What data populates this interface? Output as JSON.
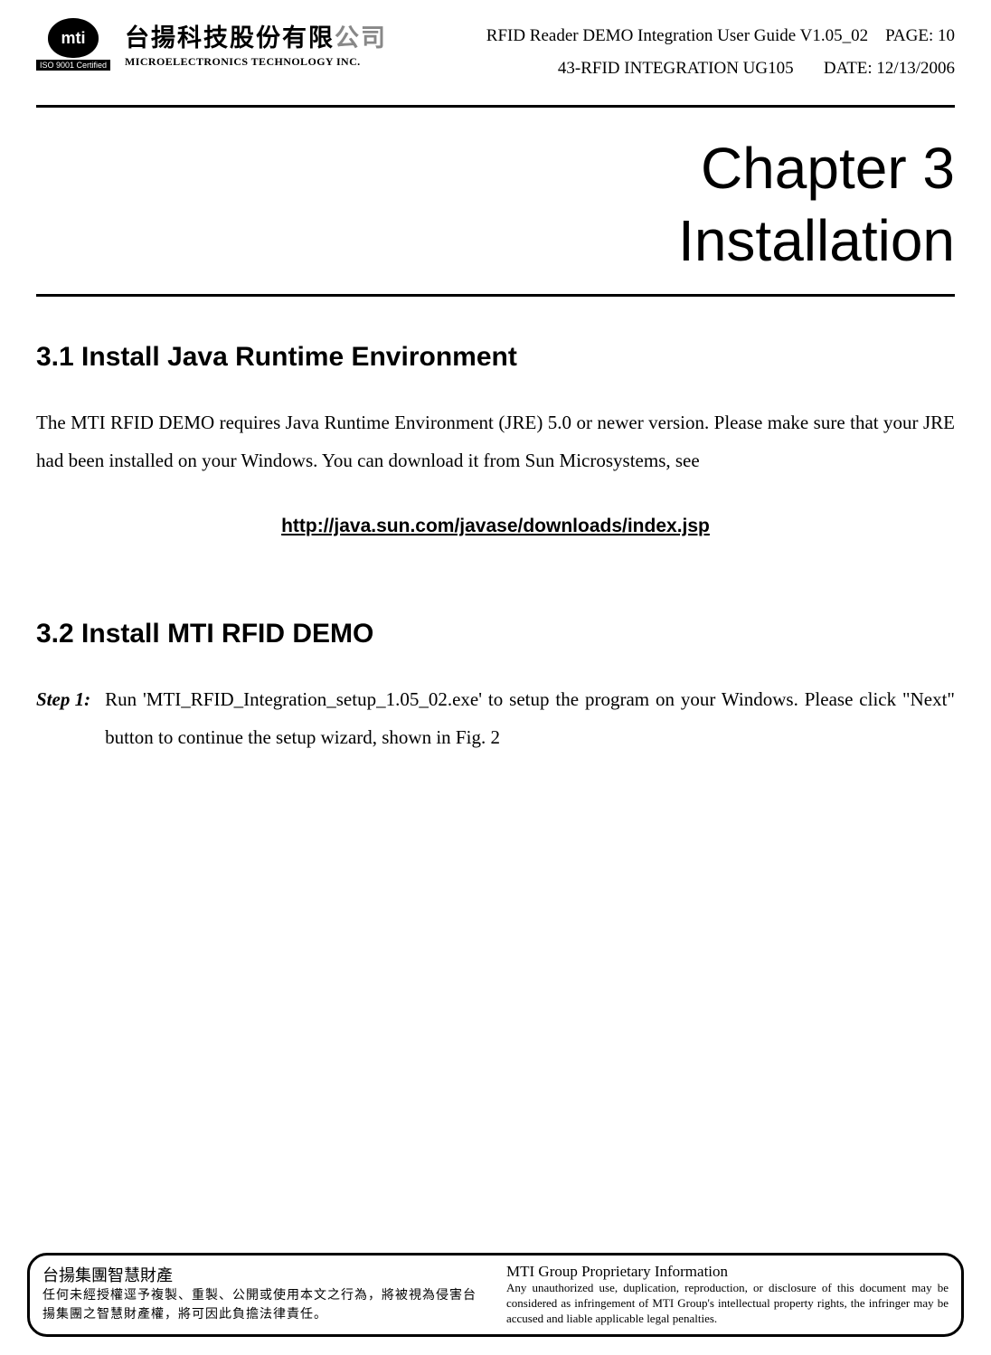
{
  "header": {
    "logo_text": "mti",
    "iso_badge": "ISO 9001 Certified",
    "company_cn_black": "台揚科技股份有限",
    "company_cn_grey": "公司",
    "company_en": "MICROELECTRONICS TECHNOLOGY INC.",
    "doc_title": "RFID Reader DEMO Integration User Guide V1.05_02",
    "page_label": "PAGE: 10",
    "doc_code": "43-RFID INTEGRATION UG105",
    "date_label": "DATE: 12/13/2006"
  },
  "chapter": {
    "number": "Chapter 3",
    "title": "Installation"
  },
  "section31": {
    "heading": "3.1  Install Java Runtime Environment",
    "body": "The MTI RFID DEMO requires Java Runtime Environment (JRE) 5.0 or newer version.   Please make sure that your JRE had been installed on your Windows. You can download it from Sun Microsystems, see",
    "link": "http://java.sun.com/javase/downloads/index.jsp"
  },
  "section32": {
    "heading": "3.2  Install MTI RFID DEMO",
    "step1_label": "Step 1:",
    "step1_body": "Run 'MTI_RFID_Integration_setup_1.05_02.exe' to setup the program on your Windows. Please click \"Next\" button to continue the setup wizard, shown in Fig. 2"
  },
  "footer": {
    "cn_title": "台揚集團智慧財產",
    "cn_body": "任何未經授權逕予複製、重製、公開或使用本文之行為，將被視為侵害台揚集團之智慧財產權，將可因此負擔法律責任。",
    "en_title": "MTI Group Proprietary Information",
    "en_body": "Any unauthorized use, duplication, reproduction, or disclosure of this document may be considered as infringement of MTI Group's intellectual property rights, the infringer may be accused and liable applicable legal penalties."
  }
}
